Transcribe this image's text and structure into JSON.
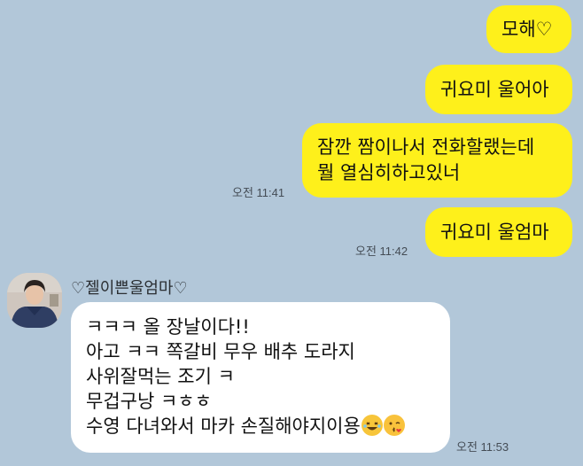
{
  "messages": {
    "m1": "모해♡",
    "m2": "귀요미 울어아",
    "m3_line1": "잠깐 짬이나서 전화할랬는데",
    "m3_line2": "뭘 열심히하고있너",
    "m3_time": "오전 11:41",
    "m4": "귀요미 울엄마",
    "m4_time": "오전 11:42"
  },
  "incoming": {
    "sender_name": "♡젤이쁜울엄마♡",
    "lines": [
      "ㅋㅋㅋ  올 장날이다!!",
      "아고 ㅋㅋ 쪽갈비 무우 배추 도라지",
      "사위잘먹는 조기 ㅋ",
      "무겁구낭 ㅋㅎㅎ",
      "수영 다녀와서 마카 손질해야지이용"
    ],
    "emojis": [
      "rolling-on-floor-laughing-emoji",
      "kissing-wink-emoji"
    ],
    "time": "오전 11:53"
  },
  "colors": {
    "background": "#b2c7d9",
    "outgoing_bubble": "#fef01b",
    "incoming_bubble": "#ffffff"
  }
}
